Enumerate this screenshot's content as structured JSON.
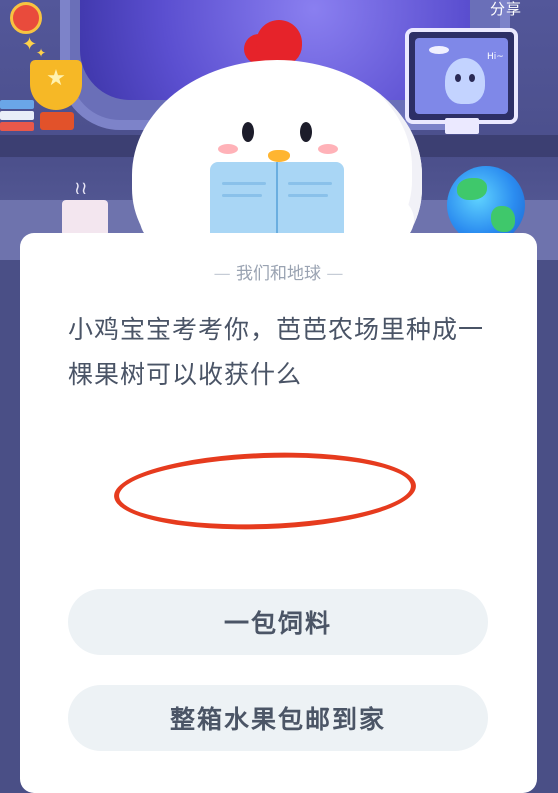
{
  "header": {
    "share_label": "分享"
  },
  "illustration": {
    "alien_greeting": "Hi~",
    "mascot": "chicken-reading-book",
    "icons": [
      "badge-icon",
      "trophy-icon",
      "globe-icon",
      "monitor-icon",
      "mug-icon",
      "satellite-icon"
    ]
  },
  "question_card": {
    "category": "我们和地球",
    "question": "小鸡宝宝考考你，芭芭农场里种成一棵果树可以收获什么",
    "options": [
      {
        "label": "一包饲料"
      },
      {
        "label": "整箱水果包邮到家",
        "highlighted": true
      }
    ]
  },
  "colors": {
    "background": "#4a4f86",
    "card": "#ffffff",
    "option_bg": "#edf2f5",
    "question_text": "#4a5466",
    "highlight_ring": "#e63b1e"
  }
}
